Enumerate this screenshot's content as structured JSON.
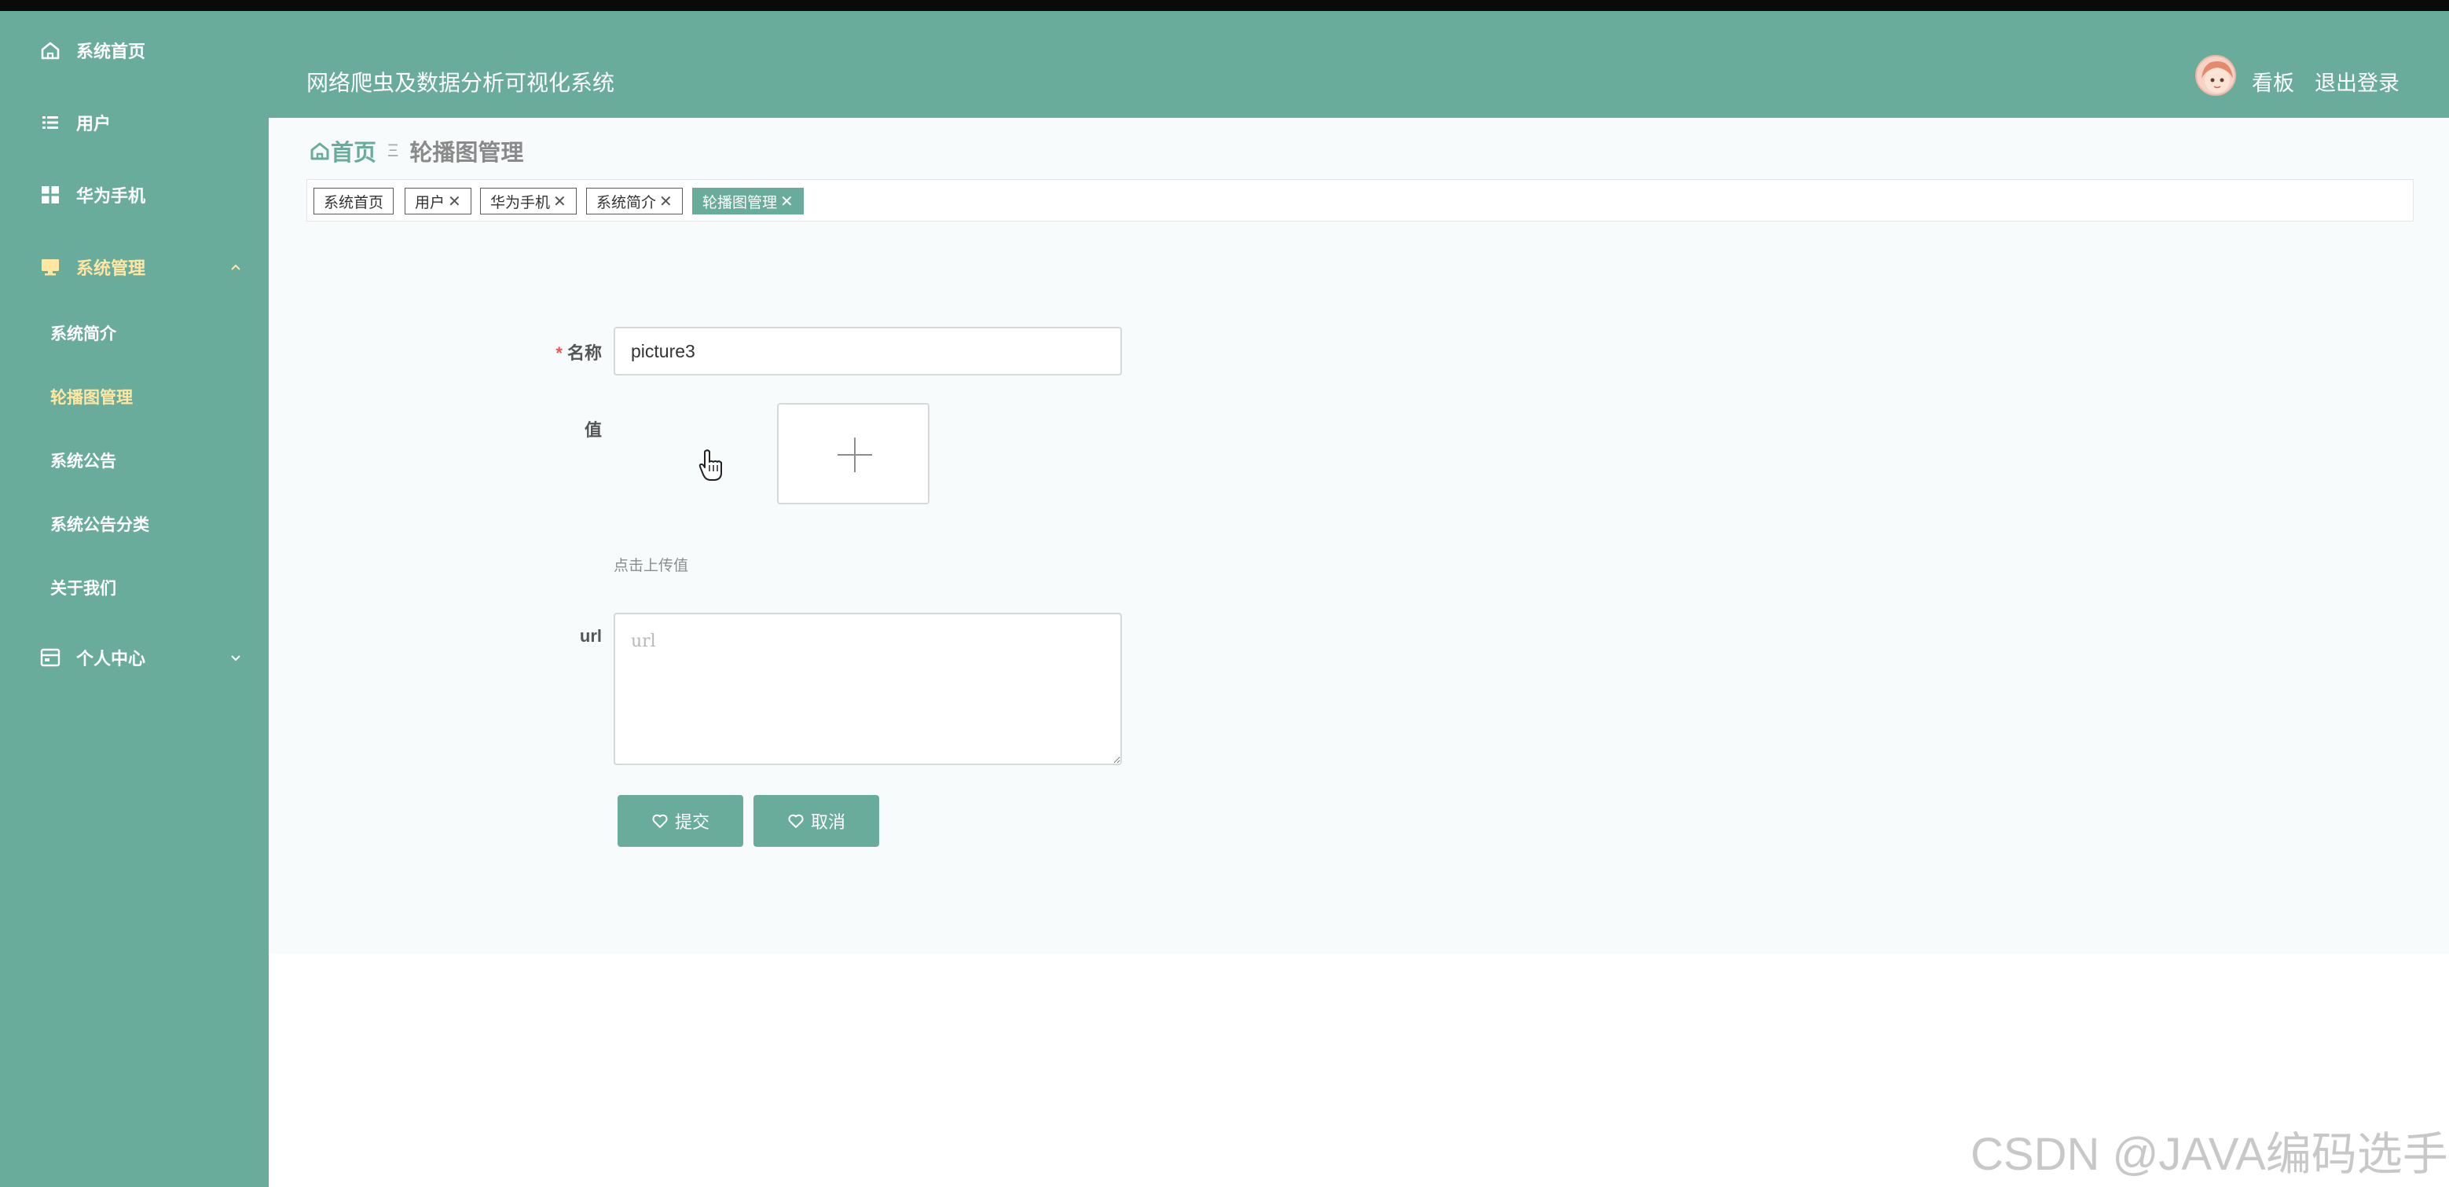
{
  "header": {
    "title": "网络爬虫及数据分析可视化系统",
    "board_link": "看板",
    "logout_link": "退出登录"
  },
  "sidebar": {
    "items": [
      {
        "label": "系统首页",
        "icon": "home-icon"
      },
      {
        "label": "用户",
        "icon": "list-icon"
      },
      {
        "label": "华为手机",
        "icon": "grid-icon"
      },
      {
        "label": "系统管理",
        "icon": "monitor-icon",
        "expanded": true
      },
      {
        "label": "个人中心",
        "icon": "card-icon",
        "expanded": false
      }
    ],
    "sub_items": [
      {
        "label": "系统简介"
      },
      {
        "label": "轮播图管理",
        "active": true
      },
      {
        "label": "系统公告"
      },
      {
        "label": "系统公告分类"
      },
      {
        "label": "关于我们"
      }
    ]
  },
  "breadcrumb": {
    "home": "首页",
    "current": "轮播图管理"
  },
  "tags": [
    {
      "label": "系统首页",
      "closable": false
    },
    {
      "label": "用户",
      "closable": true
    },
    {
      "label": "华为手机",
      "closable": true
    },
    {
      "label": "系统简介",
      "closable": true
    },
    {
      "label": "轮播图管理",
      "closable": true,
      "active": true
    }
  ],
  "form": {
    "name_label": "名称",
    "name_value": "picture3",
    "value_label": "值",
    "upload_hint": "点击上传值",
    "url_label": "url",
    "url_placeholder": "url",
    "url_value": "",
    "submit_label": "提交",
    "cancel_label": "取消"
  },
  "watermark": "CSDN @JAVA编码选手",
  "colors": {
    "primary": "#6aac9b",
    "active_text": "#ffe7a3",
    "required": "#e65a5a"
  }
}
